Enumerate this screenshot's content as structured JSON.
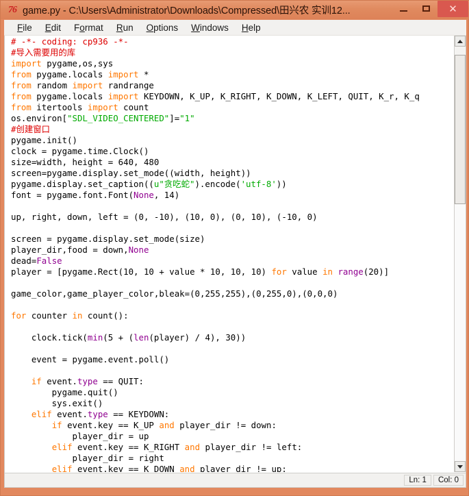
{
  "window": {
    "title": "game.py - C:\\Users\\Administrator\\Downloads\\Compressed\\田兴农 实训12...",
    "icon": "python-idle-icon",
    "icon_glyph": "76",
    "frame_color": "#e08a5f",
    "close_color": "#d9584f",
    "controls": {
      "minimize_label": "–",
      "maximize_label": "□",
      "close_label": "✕"
    }
  },
  "menubar": {
    "items": [
      {
        "label": "File",
        "mnemonic": "F",
        "rest": "ile"
      },
      {
        "label": "Edit",
        "mnemonic": "E",
        "rest": "dit"
      },
      {
        "label": "Format",
        "mnemonic": "o",
        "pre": "F",
        "rest": "rmat"
      },
      {
        "label": "Run",
        "mnemonic": "R",
        "rest": "un"
      },
      {
        "label": "Options",
        "mnemonic": "O",
        "rest": "ptions"
      },
      {
        "label": "Windows",
        "mnemonic": "W",
        "rest": "indows"
      },
      {
        "label": "Help",
        "mnemonic": "H",
        "rest": "elp"
      }
    ]
  },
  "editor": {
    "syntax_colors": {
      "keyword": "#ff7700",
      "string": "#00aa00",
      "comment": "#dd0000",
      "builtin": "#900090",
      "definition": "#0000ff",
      "plain": "#000000"
    },
    "lines": [
      "# -*- coding: cp936 -*-",
      "#导入需要用的库",
      "import pygame,os,sys",
      "from pygame.locals import *",
      "from random import randrange",
      "from pygame.locals import KEYDOWN, K_UP, K_RIGHT, K_DOWN, K_LEFT, QUIT, K_r, K_q",
      "from itertools import count",
      "os.environ[\"SDL_VIDEO_CENTERED\"]=\"1\"",
      "#创建窗口",
      "pygame.init()",
      "clock = pygame.time.Clock()",
      "size=width, height = 640, 480",
      "screen=pygame.display.set_mode((width, height))",
      "pygame.display.set_caption((u\"贪吃蛇\").encode('utf-8'))",
      "font = pygame.font.Font(None, 14)",
      "",
      "up, right, down, left = (0, -10), (10, 0), (0, 10), (-10, 0)",
      "",
      "screen = pygame.display.set_mode(size)",
      "player_dir,food = down,None",
      "dead=False",
      "player = [pygame.Rect(10, 10 + value * 10, 10, 10) for value in range(20)]",
      "",
      "game_color,game_player_color,bleak=(0,255,255),(0,255,0),(0,0,0)",
      "",
      "for counter in count():",
      "",
      "    clock.tick(min(5 + (len(player) / 4), 30))",
      "",
      "    event = pygame.event.poll()",
      "",
      "    if event.type == QUIT:",
      "        pygame.quit()",
      "        sys.exit()",
      "    elif event.type == KEYDOWN:",
      "        if event.key == K_UP and player_dir != down:",
      "            player_dir = up",
      "        elif event.key == K_RIGHT and player_dir != left:",
      "            player_dir = right",
      "        elif event.key == K_DOWN and player_dir != up:"
    ]
  },
  "scrollbar": {
    "up_arrow": "scroll-up-arrow",
    "down_arrow": "scroll-down-arrow",
    "thumb_top_pct": 2,
    "thumb_height_pct": 36
  },
  "statusbar": {
    "line_label": "Ln: 1",
    "col_label": "Col: 0"
  }
}
